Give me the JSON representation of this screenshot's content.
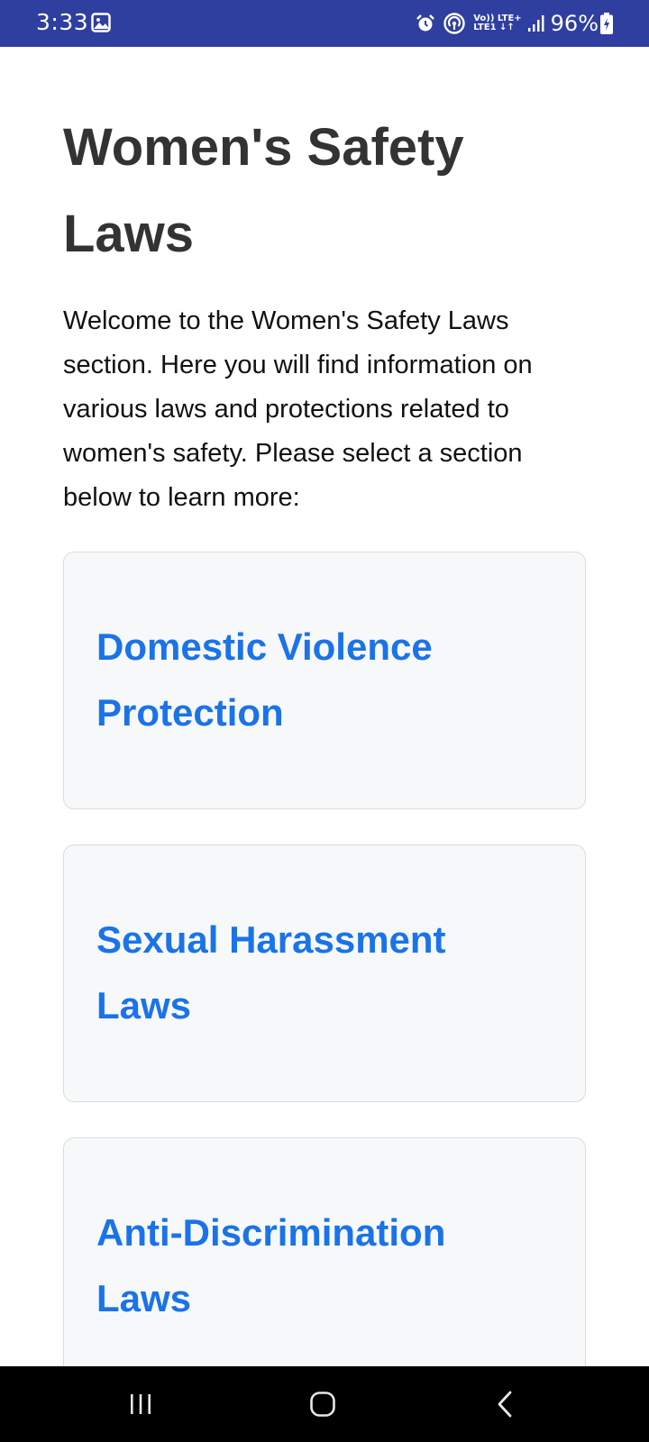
{
  "status_bar": {
    "time": "3:33",
    "network_top": "Vo)) LTE+",
    "network_bottom": "LTE1 ↓↑",
    "battery": "96%",
    "icons": [
      "gallery-icon",
      "alarm-icon",
      "hotspot-icon",
      "signal-icon",
      "battery-charging-icon"
    ]
  },
  "page": {
    "title": "Women's Safety Laws",
    "intro": "Welcome to the Women's Safety Laws section. Here you will find information on various laws and protections related to women's safety. Please select a section below to learn more:"
  },
  "sections": [
    {
      "title": "Domestic Violence Protection"
    },
    {
      "title": "Sexual Harassment Laws"
    },
    {
      "title": "Anti-Discrimination Laws"
    }
  ],
  "nav_bar": {
    "icons": [
      "recents-icon",
      "home-icon",
      "back-icon"
    ]
  },
  "colors": {
    "status_bar": "#2f3f9f",
    "title_text": "#333333",
    "link_blue": "#1a73e8",
    "card_bg": "#f7f8f9",
    "card_border": "#dcdcdc"
  }
}
